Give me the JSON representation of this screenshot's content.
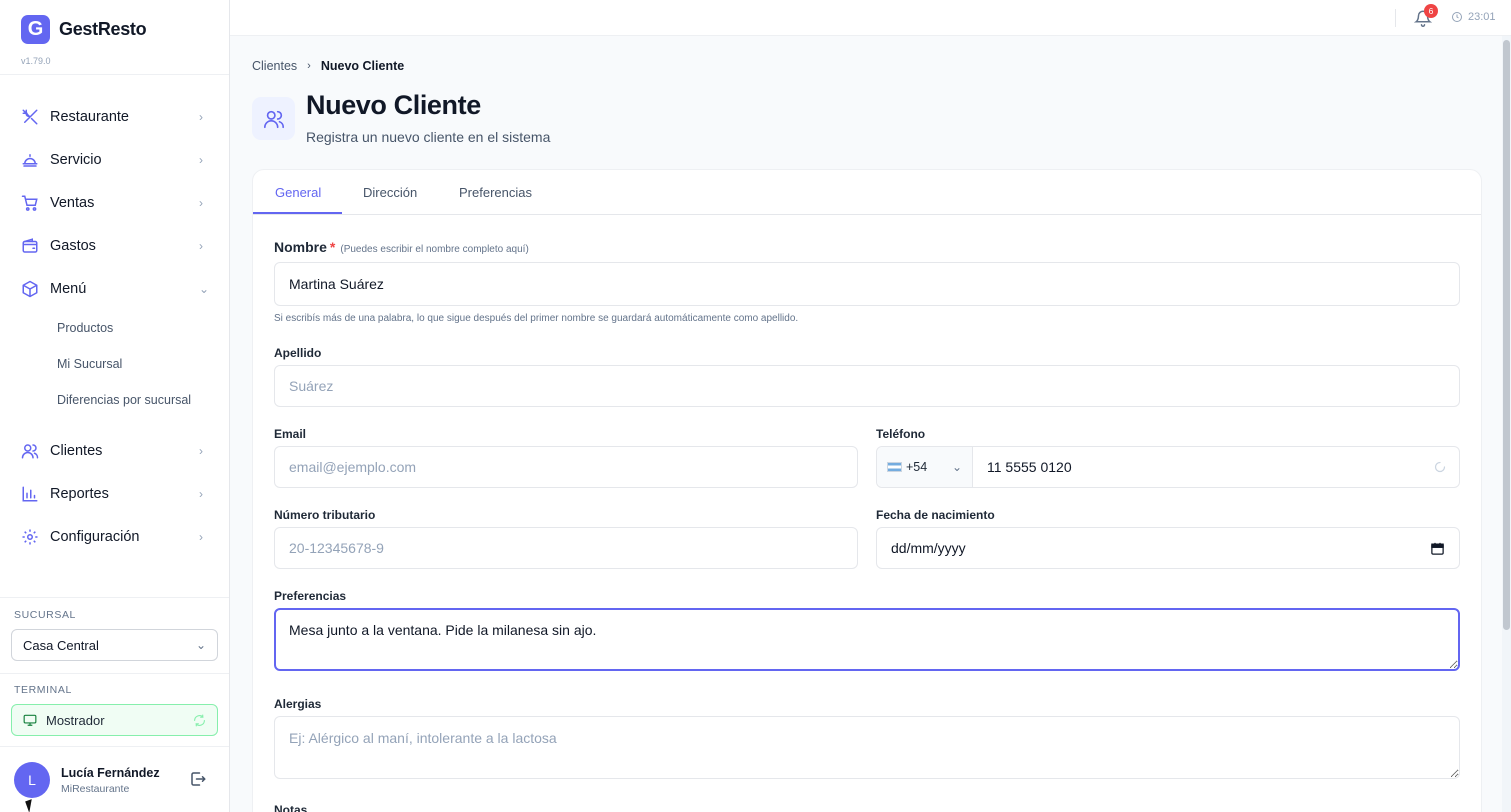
{
  "brand": {
    "logo_letter": "G",
    "name": "GestResto",
    "version": "v1.79.0",
    "accent": "#6366f1"
  },
  "sidebar": {
    "items": [
      {
        "label": "Restaurante",
        "icon": "utensils-icon"
      },
      {
        "label": "Servicio",
        "icon": "cloche-icon"
      },
      {
        "label": "Ventas",
        "icon": "cart-icon"
      },
      {
        "label": "Gastos",
        "icon": "wallet-icon"
      },
      {
        "label": "Menú",
        "icon": "box-icon",
        "expanded": true
      },
      {
        "label": "Clientes",
        "icon": "users-icon"
      },
      {
        "label": "Reportes",
        "icon": "bar-chart-icon"
      },
      {
        "label": "Configuración",
        "icon": "gear-icon"
      }
    ],
    "menu_sub": [
      "Productos",
      "Mi Sucursal",
      "Diferencias por sucursal"
    ],
    "branch_label": "SUCURSAL",
    "branch_value": "Casa Central",
    "terminal_label": "TERMINAL",
    "terminal_value": "Mostrador",
    "user": {
      "initial": "L",
      "name": "Lucía Fernández",
      "org": "MiRestaurante"
    }
  },
  "topbar": {
    "notifications": "6",
    "time": "23:01"
  },
  "breadcrumb": {
    "parent": "Clientes",
    "current": "Nuevo Cliente"
  },
  "page": {
    "title": "Nuevo Cliente",
    "subtitle": "Registra un nuevo cliente en el sistema"
  },
  "tabs": [
    "General",
    "Dirección",
    "Preferencias"
  ],
  "form": {
    "nombre": {
      "label": "Nombre",
      "required": "*",
      "hint": "(Puedes escribir el nombre completo aquí)",
      "value": "Martina Suárez",
      "help": "Si escribís más de una palabra, lo que sigue después del primer nombre se guardará automáticamente como apellido."
    },
    "apellido": {
      "label": "Apellido",
      "placeholder": "Suárez"
    },
    "email": {
      "label": "Email",
      "placeholder": "email@ejemplo.com"
    },
    "telefono": {
      "label": "Teléfono",
      "country_code": "+54",
      "value": "11 5555 0120"
    },
    "tributario": {
      "label": "Número tributario",
      "placeholder": "20-12345678-9"
    },
    "nacimiento": {
      "label": "Fecha de nacimiento",
      "value": "dd/mm/yyyy"
    },
    "preferencias": {
      "label": "Preferencias",
      "value": "Mesa junto a la ventana. Pide la milanesa sin ajo."
    },
    "alergias": {
      "label": "Alergias",
      "placeholder": "Ej: Alérgico al maní, intolerante a la lactosa"
    },
    "notas": {
      "label": "Notas"
    }
  }
}
